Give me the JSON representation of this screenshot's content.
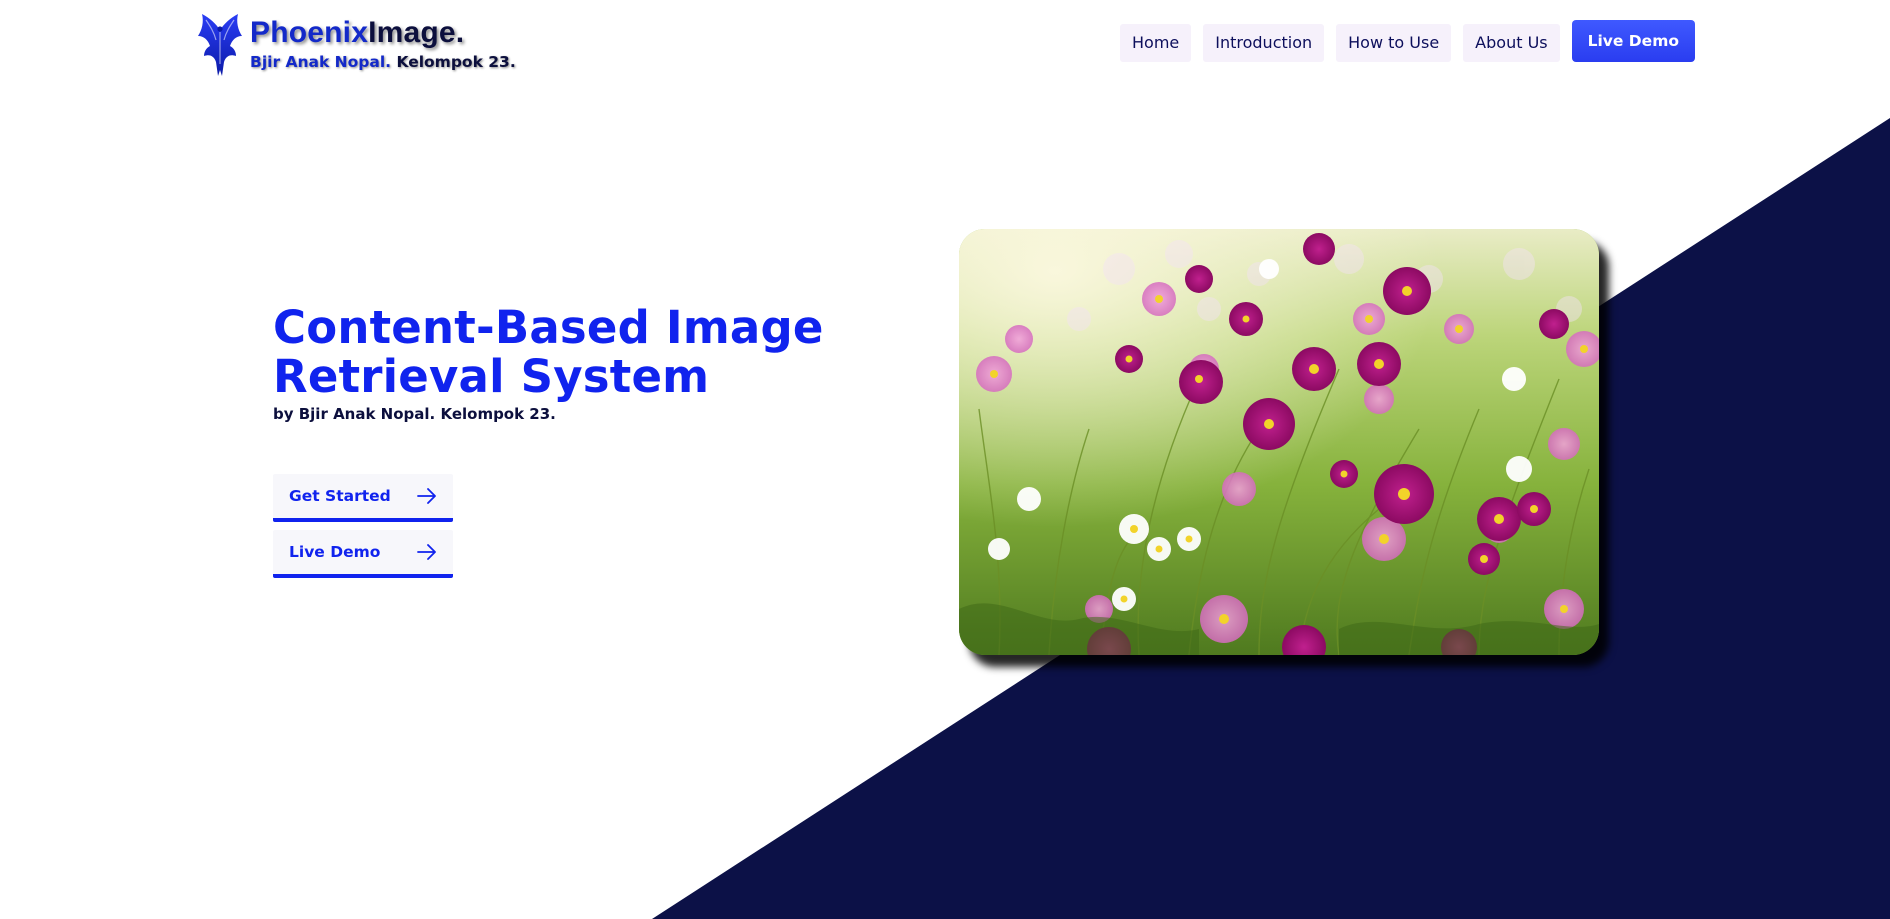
{
  "brand": {
    "title_main": "Phoenix",
    "title_rest": "Image.",
    "subtitle_main": "Bjir Anak Nopal.",
    "subtitle_rest": " Kelompok 23.",
    "logo_icon": "phoenix-icon"
  },
  "nav": {
    "items": [
      {
        "label": "Home"
      },
      {
        "label": "Introduction"
      },
      {
        "label": "How to Use"
      },
      {
        "label": "About Us"
      }
    ],
    "cta_label": "Live Demo"
  },
  "hero": {
    "title": "Content-Based Image Retrieval System",
    "subtitle": "by Bjir Anak Nopal. Kelompok 23.",
    "buttons": [
      {
        "label": "Get Started",
        "icon": "arrow-right-icon"
      },
      {
        "label": "Live Demo",
        "icon": "arrow-right-icon"
      }
    ],
    "image_subject": "cosmos flower field"
  },
  "colors": {
    "accent": "#1023ee",
    "navy": "#0c1147",
    "nav_bg": "#f6f1fb",
    "nav_cta": "#3f59ff"
  }
}
